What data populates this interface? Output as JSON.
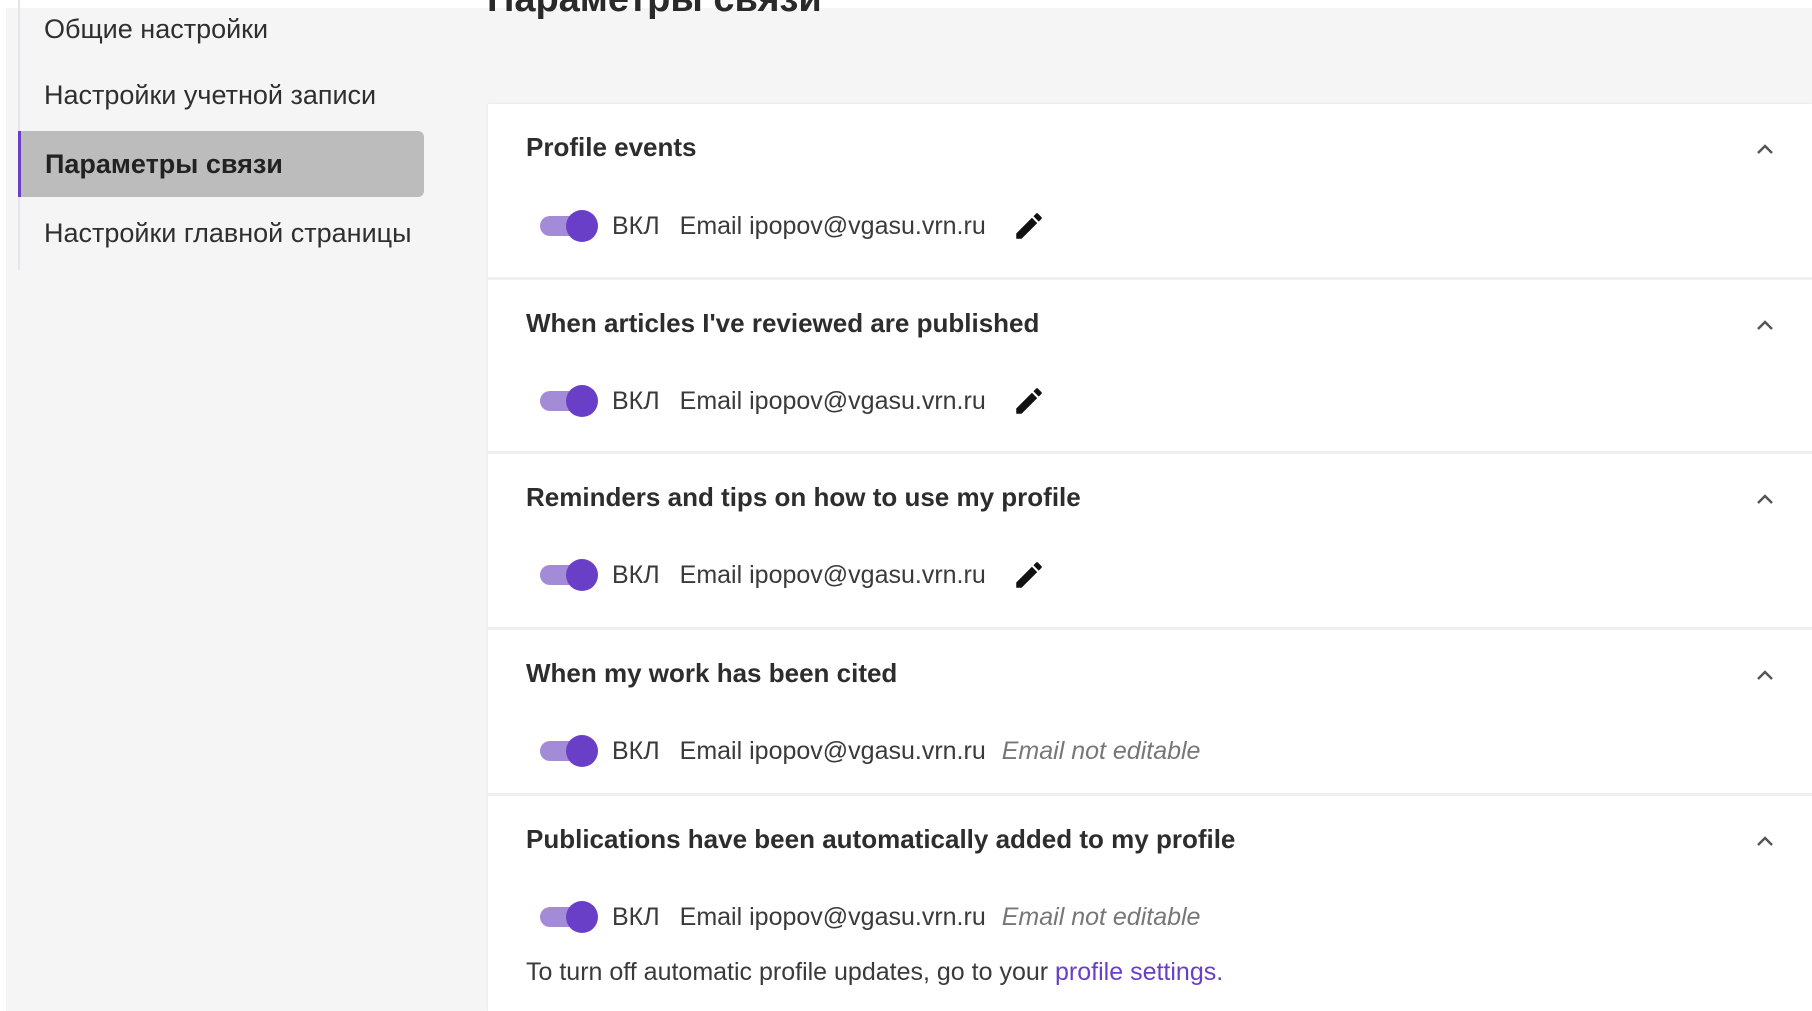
{
  "page": {
    "title": "Параметры связи"
  },
  "sidebar": {
    "items": [
      {
        "label": "Общие настройки",
        "active": false
      },
      {
        "label": "Настройки учетной записи",
        "active": false
      },
      {
        "label": "Параметры связи",
        "active": true
      },
      {
        "label": "Настройки главной страницы",
        "active": false
      }
    ]
  },
  "sections": [
    {
      "title": "Profile events",
      "state": "ВКЛ",
      "email": "Email ipopov@vgasu.vrn.ru",
      "editable": true
    },
    {
      "title": "When articles I've reviewed are published",
      "state": "ВКЛ",
      "email": "Email ipopov@vgasu.vrn.ru",
      "editable": true
    },
    {
      "title": "Reminders and tips on how to use my profile",
      "state": "ВКЛ",
      "email": "Email ipopov@vgasu.vrn.ru",
      "editable": true
    },
    {
      "title": "When my work has been cited",
      "state": "ВКЛ",
      "email": "Email ipopov@vgasu.vrn.ru",
      "editable": false,
      "note": "Email not editable"
    },
    {
      "title": "Publications have been automatically added to my profile",
      "state": "ВКЛ",
      "email": "Email ipopov@vgasu.vrn.ru",
      "editable": false,
      "note": "Email not editable"
    }
  ],
  "footnote": {
    "text": "To turn off automatic profile updates, go to your ",
    "link": "profile settings."
  },
  "colors": {
    "accent": "#6a3fc8",
    "toggle_track": "#a48bd8",
    "active_bg": "#bcbcbc"
  }
}
